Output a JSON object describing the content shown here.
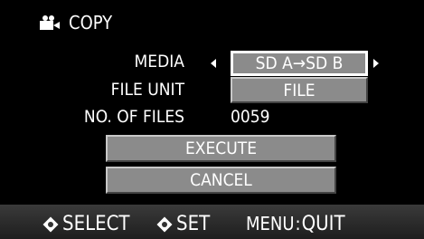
{
  "header": {
    "icon": "movie-camera-icon",
    "title": "COPY"
  },
  "media": {
    "label": "MEDIA",
    "value": "SD A→SD B"
  },
  "file_unit": {
    "label": "FILE UNIT",
    "value": "FILE"
  },
  "files": {
    "label": "NO. OF FILES",
    "value": "0059"
  },
  "execute_label": "EXECUTE",
  "cancel_label": "CANCEL",
  "footer": {
    "select": "SELECT",
    "set": "SET",
    "menu": "MENU",
    "quit": "QUIT"
  },
  "colors": {
    "background": "#000000",
    "button": "#8b8b8b",
    "text": "#ffffff"
  }
}
